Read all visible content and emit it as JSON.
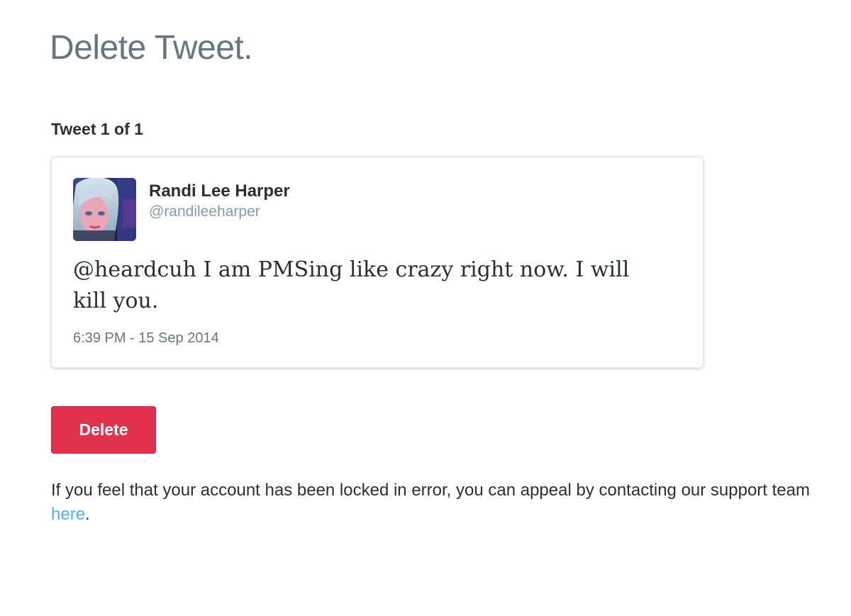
{
  "page": {
    "title": "Delete Tweet."
  },
  "tweet_counter": "Tweet 1 of 1",
  "tweet": {
    "author_name": "Randi Lee Harper",
    "author_handle": "@randileeharper",
    "text": "@heardcuh I am PMSing like crazy right now. I will kill you.",
    "timestamp": "6:39 PM - 15 Sep 2014",
    "avatar_icon": "profile-photo"
  },
  "actions": {
    "delete_label": "Delete",
    "delete_color": "#e0324f"
  },
  "appeal": {
    "text_before": "If you feel that your account has been locked in error, you can appeal by contacting our support team ",
    "link_label": "here",
    "text_after": ".",
    "link_color": "#55acee"
  }
}
